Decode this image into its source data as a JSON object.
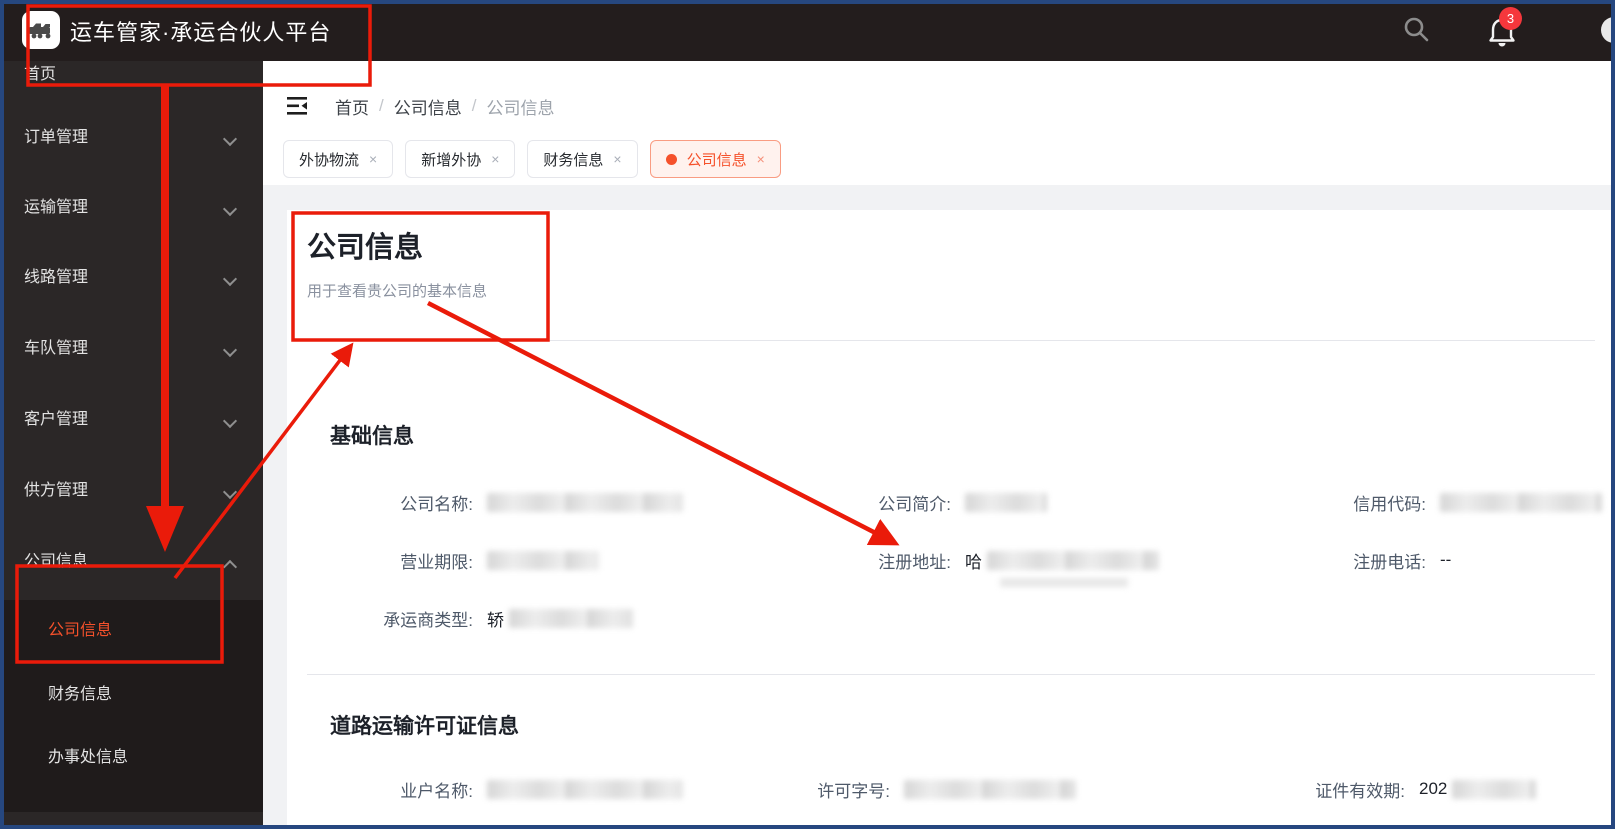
{
  "colors": {
    "accent": "#F5512B",
    "annotation_red": "#EA1B0A",
    "badge_red": "#F5373C",
    "frame_border": "#26477F"
  },
  "header": {
    "app_title": "运车管家·承运合伙人平台",
    "notification_count": "3"
  },
  "sidebar": {
    "items": [
      {
        "label": "首页"
      },
      {
        "label": "订单管理",
        "chevron": "down"
      },
      {
        "label": "运输管理",
        "chevron": "down"
      },
      {
        "label": "线路管理",
        "chevron": "down"
      },
      {
        "label": "车队管理",
        "chevron": "down"
      },
      {
        "label": "客户管理",
        "chevron": "down"
      },
      {
        "label": "供方管理",
        "chevron": "down"
      },
      {
        "label": "公司信息",
        "chevron": "up"
      }
    ],
    "submenu": [
      {
        "label": "公司信息",
        "active": true
      },
      {
        "label": "财务信息",
        "active": false
      },
      {
        "label": "办事处信息",
        "active": false
      }
    ]
  },
  "breadcrumb": {
    "separator": "/",
    "items": [
      "首页",
      "公司信息",
      "公司信息"
    ]
  },
  "tabs": [
    {
      "label": "外协物流",
      "close": "×",
      "active": false
    },
    {
      "label": "新增外协",
      "close": "×",
      "active": false
    },
    {
      "label": "财务信息",
      "close": "×",
      "active": false
    },
    {
      "label": "公司信息",
      "close": "×",
      "active": true
    }
  ],
  "page": {
    "title": "公司信息",
    "subtitle": "用于查看贵公司的基本信息"
  },
  "basic_info": {
    "title": "基础信息",
    "company_name_label": "公司名称:",
    "company_intro_label": "公司简介:",
    "credit_code_label": "信用代码:",
    "business_term_label": "营业期限:",
    "registered_address_label": "注册地址:",
    "registered_address_value_prefix": "哈",
    "registered_phone_label": "注册电话:",
    "registered_phone_value": "--",
    "carrier_type_label": "承运商类型:",
    "carrier_type_value_prefix": "轿"
  },
  "license_info": {
    "title": "道路运输许可证信息",
    "operator_name_label": "业户名称:",
    "license_no_label": "许可字号:",
    "validity_label": "证件有效期:",
    "validity_value_prefix": "202"
  }
}
